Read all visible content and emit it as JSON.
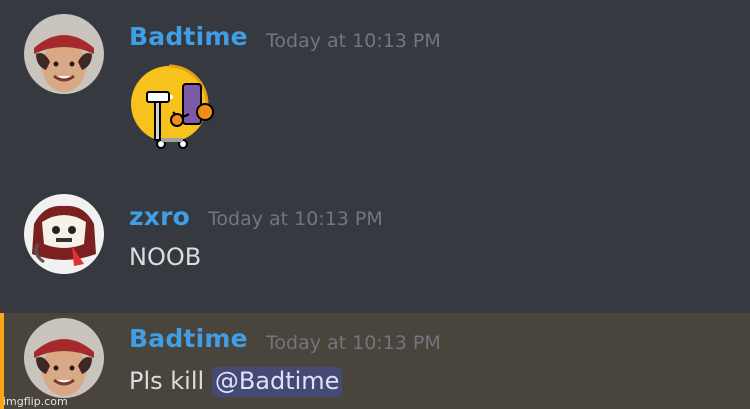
{
  "messages": [
    {
      "author": "Badtime",
      "author_color": "#3f9ee5",
      "timestamp": "Today at 10:13 PM",
      "content": ""
    },
    {
      "author": "zxro",
      "author_color": "#3f9ee5",
      "timestamp": "Today at 10:13 PM",
      "content": "NOOB"
    },
    {
      "author": "Badtime",
      "author_color": "#3f9ee5",
      "timestamp": "Today at 10:13 PM",
      "content": "Pls kill ",
      "mention": "@Badtime"
    }
  ],
  "sticker": {
    "icon": "sticker-duck-icon"
  },
  "highlight_color": "#faa81a",
  "watermark": "imgflip.com"
}
